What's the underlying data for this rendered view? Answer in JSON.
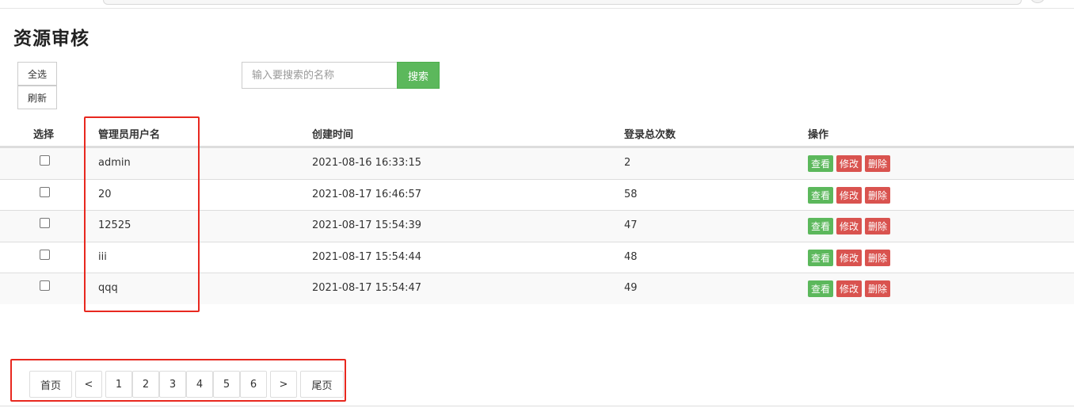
{
  "page": {
    "title": "资源审核"
  },
  "toolbar": {
    "select_all_label": "全选",
    "refresh_label": "刷新"
  },
  "search": {
    "placeholder": "输入要搜索的名称",
    "value": "",
    "button_label": "搜索"
  },
  "table": {
    "headers": [
      "选择",
      "管理员用户名",
      "创建时间",
      "登录总次数",
      "操作"
    ],
    "rows": [
      {
        "username": "admin",
        "created": "2021-08-16 16:33:15",
        "logins": "2",
        "checked": false
      },
      {
        "username": "20",
        "created": "2021-08-17 16:46:57",
        "logins": "58",
        "checked": false
      },
      {
        "username": "12525",
        "created": "2021-08-17 15:54:39",
        "logins": "47",
        "checked": false
      },
      {
        "username": "iii",
        "created": "2021-08-17 15:54:44",
        "logins": "48",
        "checked": false
      },
      {
        "username": "qqq",
        "created": "2021-08-17 15:54:47",
        "logins": "49",
        "checked": false
      }
    ],
    "actions": {
      "view": "查看",
      "edit": "修改",
      "delete": "删除"
    }
  },
  "pagination": {
    "first": "首页",
    "prev": "<",
    "pages": [
      "1",
      "2",
      "3",
      "4",
      "5",
      "6"
    ],
    "next": ">",
    "last": "尾页"
  },
  "colors": {
    "success": "#5cb85c",
    "danger": "#d9534f",
    "highlight_box": "#e8281f"
  }
}
